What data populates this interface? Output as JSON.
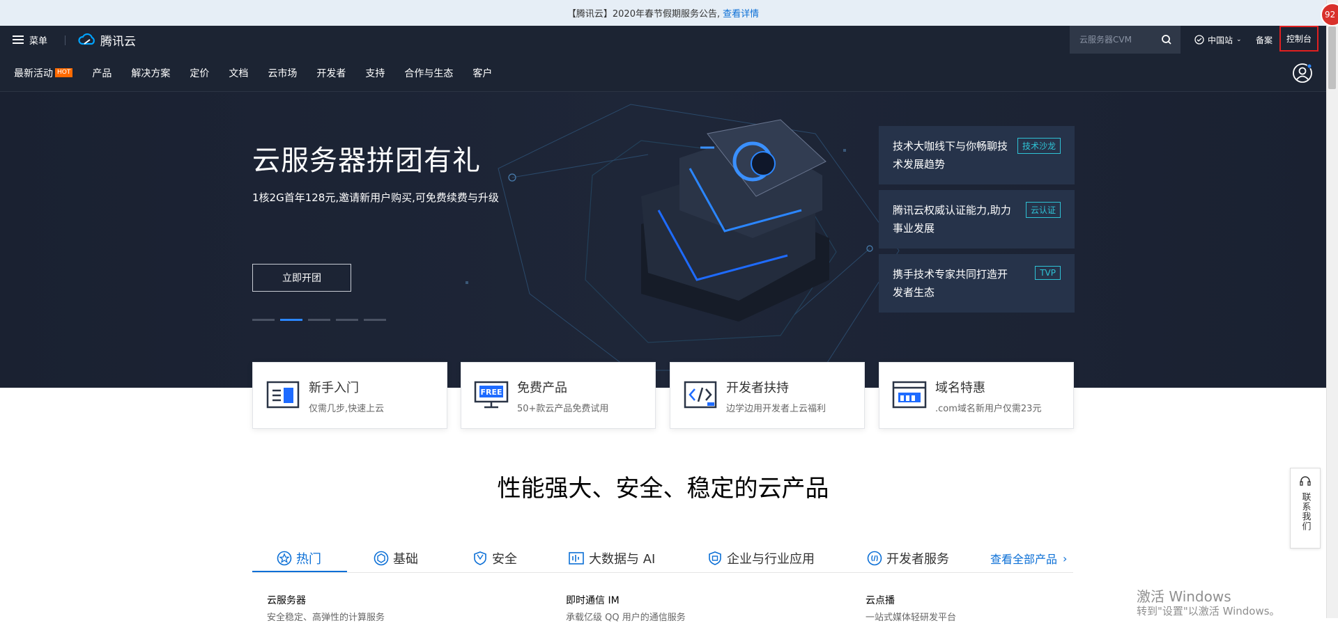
{
  "notice": {
    "text": "【腾讯云】2020年春节假期服务公告,",
    "link": "查看详情"
  },
  "badge": {
    "count": "92"
  },
  "topbar": {
    "menu_label": "菜单",
    "logo_text": "腾讯云",
    "search_placeholder": "云服务器CVM",
    "region": "中国站",
    "beian": "备案",
    "console": "控制台"
  },
  "nav": {
    "items": [
      {
        "label": "最新活动",
        "badge": "HOT"
      },
      {
        "label": "产品"
      },
      {
        "label": "解决方案"
      },
      {
        "label": "定价"
      },
      {
        "label": "文档"
      },
      {
        "label": "云市场"
      },
      {
        "label": "开发者"
      },
      {
        "label": "支持"
      },
      {
        "label": "合作与生态"
      },
      {
        "label": "客户"
      }
    ]
  },
  "hero": {
    "title": "云服务器拼团有礼",
    "subtitle": "1核2G首年128元,邀请新用户购买,可免费续费与升级",
    "button": "立即开团",
    "slides": 5,
    "active_slide": 1
  },
  "promos": [
    {
      "text": "技术大咖线下与你畅聊技术发展趋势",
      "tag": "技术沙龙"
    },
    {
      "text": "腾讯云权威认证能力,助力事业发展",
      "tag": "云认证"
    },
    {
      "text": "携手技术专家共同打造开发者生态",
      "tag": "TVP"
    }
  ],
  "quick": [
    {
      "title": "新手入门",
      "desc": "仅需几步,快速上云",
      "icon": "book-icon"
    },
    {
      "title": "免费产品",
      "desc": "50+款云产品免费试用",
      "icon": "free-icon"
    },
    {
      "title": "开发者扶持",
      "desc": "边学边用开发者上云福利",
      "icon": "code-icon"
    },
    {
      "title": "域名特惠",
      "desc": ".com域名新用户仅需23元",
      "icon": "domain-icon"
    }
  ],
  "section": {
    "title": "性能强大、安全、稳定的云产品"
  },
  "tabs": [
    {
      "label": "热门",
      "icon": "star-icon"
    },
    {
      "label": "基础",
      "icon": "cube-icon"
    },
    {
      "label": "安全",
      "icon": "shield-icon"
    },
    {
      "label": "大数据与 AI",
      "icon": "data-icon"
    },
    {
      "label": "企业与行业应用",
      "icon": "enterprise-icon"
    },
    {
      "label": "开发者服务",
      "icon": "dev-icon"
    }
  ],
  "view_all": "查看全部产品",
  "products": [
    {
      "name": "云服务器",
      "desc": "安全稳定、高弹性的计算服务"
    },
    {
      "name": "即时通信 IM",
      "desc": "承载亿级 QQ 用户的通信服务"
    },
    {
      "name": "云点播",
      "desc": "一站式媒体轻研发平台"
    }
  ],
  "contact": "联系我们",
  "watermark": {
    "line1": "激活 Windows",
    "line2": "转到\"设置\"以激活 Windows。"
  },
  "colors": {
    "dark_bg": "#1c2433",
    "accent": "#0b6fd6",
    "hot": "#ff6a00",
    "tag": "#2fc3d6"
  }
}
